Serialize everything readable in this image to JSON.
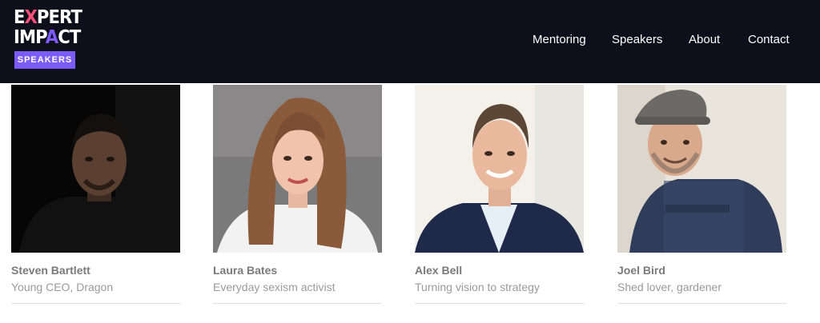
{
  "brand": {
    "line1": [
      "E",
      "X",
      "PERT"
    ],
    "line2": [
      "IMP",
      "A",
      "CT"
    ],
    "badge": "SPEAKERS",
    "colors": {
      "header_bg": "#0f0f1c",
      "accent_purple": "#7b5cff",
      "accent_pink": "#ff4f7b"
    }
  },
  "nav": {
    "items": [
      {
        "label": "Mentoring"
      },
      {
        "label": "Speakers"
      },
      {
        "label": "About"
      },
      {
        "label": "Contact"
      }
    ]
  },
  "speakers": [
    {
      "name": "Steven Bartlett",
      "tagline": "Young CEO, Dragon"
    },
    {
      "name": "Laura Bates",
      "tagline": "Everyday sexism activist"
    },
    {
      "name": "Alex Bell",
      "tagline": "Turning vision to strategy"
    },
    {
      "name": "Joel Bird",
      "tagline": "Shed lover, gardener"
    }
  ]
}
